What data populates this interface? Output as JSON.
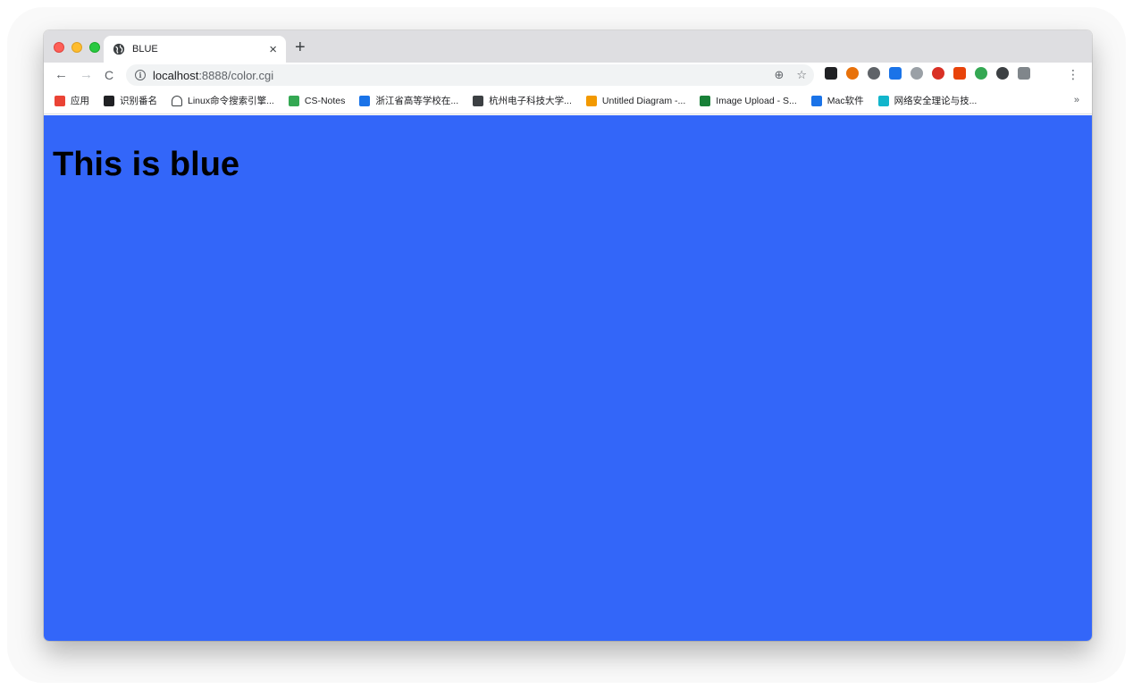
{
  "browser": {
    "tab": {
      "title": "BLUE",
      "close_label": "×"
    },
    "new_tab_label": "+",
    "nav": {
      "back": "←",
      "forward": "→",
      "reload": "C"
    },
    "address": {
      "host": "localhost",
      "rest": ":8888/color.cgi"
    },
    "omnibox_actions": {
      "zoom": "⊕",
      "star": "☆"
    },
    "extensions": [
      {
        "name": "extension-1",
        "color": "#202124"
      },
      {
        "name": "extension-2",
        "color": "#e8710a"
      },
      {
        "name": "extension-3",
        "color": "#5f6368"
      },
      {
        "name": "extension-4",
        "color": "#1a73e8"
      },
      {
        "name": "extension-5",
        "color": "#9aa0a6"
      },
      {
        "name": "extension-6",
        "color": "#d93025"
      },
      {
        "name": "extension-7",
        "color": "#e8430a"
      },
      {
        "name": "extension-8",
        "color": "#34a853"
      },
      {
        "name": "extension-9",
        "color": "#3c4043"
      },
      {
        "name": "extension-10",
        "color": "#80868b"
      }
    ],
    "menu_label": "⋮",
    "bookmarks": [
      {
        "label": "应用",
        "color": "#ea4335"
      },
      {
        "label": "识别番名",
        "color": "#202124"
      },
      {
        "label": "Linux命令搜索引擎...",
        "color": "#ffffff"
      },
      {
        "label": "CS-Notes",
        "color": "#34a853"
      },
      {
        "label": "浙江省高等学校在...",
        "color": "#1a73e8"
      },
      {
        "label": "杭州电子科技大学...",
        "color": "#3c4043"
      },
      {
        "label": "Untitled Diagram -...",
        "color": "#f29900"
      },
      {
        "label": "Image Upload - S...",
        "color": "#188038"
      },
      {
        "label": "Mac软件",
        "color": "#1a73e8"
      },
      {
        "label": "网络安全理论与技...",
        "color": "#12b5cb"
      }
    ],
    "bookmarks_more": "»"
  },
  "page": {
    "heading": "This is blue",
    "background_color": "#3366f9"
  }
}
